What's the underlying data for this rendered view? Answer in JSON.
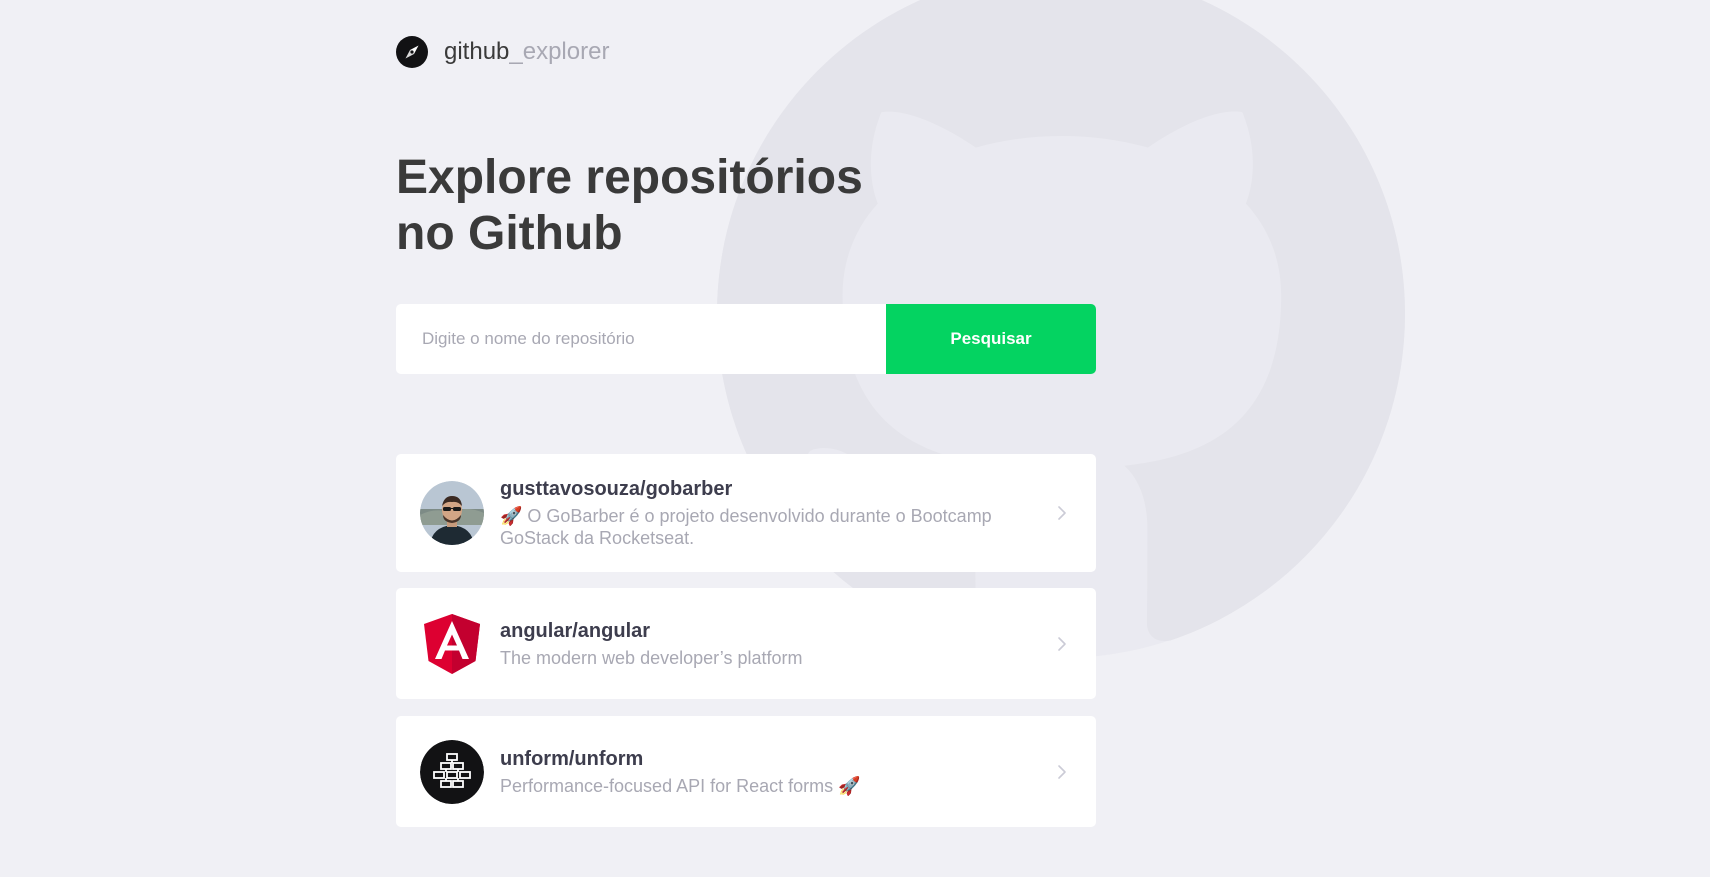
{
  "header": {
    "brand_main": "github",
    "brand_muted": "_explorer"
  },
  "title": {
    "line1": "Explore repositórios",
    "line2": "no Github"
  },
  "search": {
    "placeholder": "Digite o nome do repositório",
    "button_label": "Pesquisar"
  },
  "repositories": [
    {
      "name": "gusttavosouza/gobarber",
      "description": "🚀 O GoBarber é o projeto desenvolvido durante o Bootcamp GoStack da Rocketseat."
    },
    {
      "name": "angular/angular",
      "description": "The modern web developer’s platform"
    },
    {
      "name": "unform/unform",
      "description": "Performance-focused API for React forms 🚀"
    }
  ],
  "colors": {
    "background": "#f0f0f5",
    "accent": "#04d361",
    "title": "#3a3a3a",
    "muted": "#a8a8b3",
    "angular_red": "#dd0031"
  },
  "icons": {
    "brand": "compass-icon",
    "background": "github-octocat-logo",
    "row_arrow": "chevron-right-icon"
  }
}
